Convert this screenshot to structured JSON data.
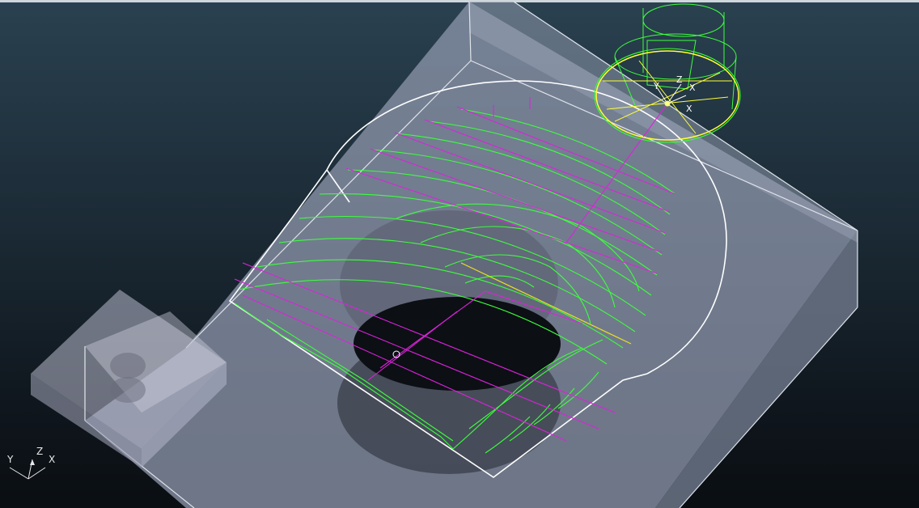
{
  "view": {
    "background_top": "#2a4150",
    "background_bottom": "#0a0e12",
    "toolpath_cut_color": "#33ff33",
    "toolpath_rapid_color": "#dd22dd",
    "tool_holder_color": "#33ff33",
    "tool_tip_color": "#ffff33",
    "edge_color": "#ffffff"
  },
  "tool_axes": {
    "x": "X",
    "y": "Y",
    "z": "Z",
    "x2": "X"
  },
  "triad": {
    "x": "X",
    "y": "Y",
    "z": "Z"
  }
}
